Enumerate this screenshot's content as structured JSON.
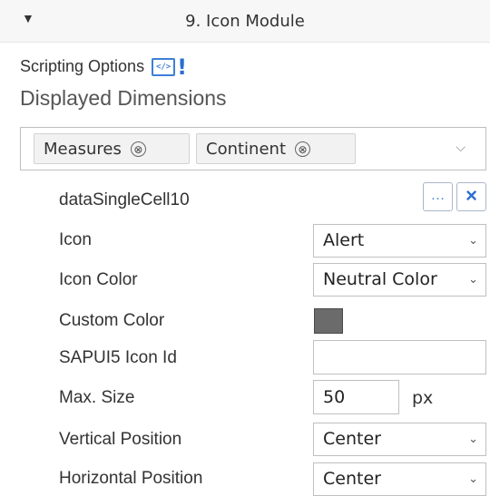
{
  "header": {
    "title": "9. Icon Module",
    "collapse_icon": "collapse-arrow-icon"
  },
  "scripting": {
    "label": "Scripting Options",
    "icon_text": "</>",
    "icon_bang": "!"
  },
  "dimensions": {
    "title": "Displayed Dimensions",
    "tokens": [
      {
        "label": "Measures"
      },
      {
        "label": "Continent"
      }
    ],
    "remove_glyph": "⊗",
    "dropdown_glyph": "⌵"
  },
  "cell": {
    "name": "dataSingleCell10",
    "more_glyph": "…",
    "remove_glyph": "×"
  },
  "properties": {
    "icon_label": "Icon",
    "icon_value": "Alert",
    "icon_color_label": "Icon Color",
    "icon_color_value": "Neutral Color",
    "custom_color_label": "Custom Color",
    "custom_color_value": "#6b6b6b",
    "sapui5_label": "SAPUI5 Icon Id",
    "sapui5_value": "",
    "max_size_label": "Max. Size",
    "max_size_value": "50",
    "max_size_unit": "px",
    "vertical_label": "Vertical Position",
    "vertical_value": "Center",
    "horizontal_label": "Horizontal Position",
    "horizontal_value": "Center"
  },
  "chevron_glyph": "⌄"
}
